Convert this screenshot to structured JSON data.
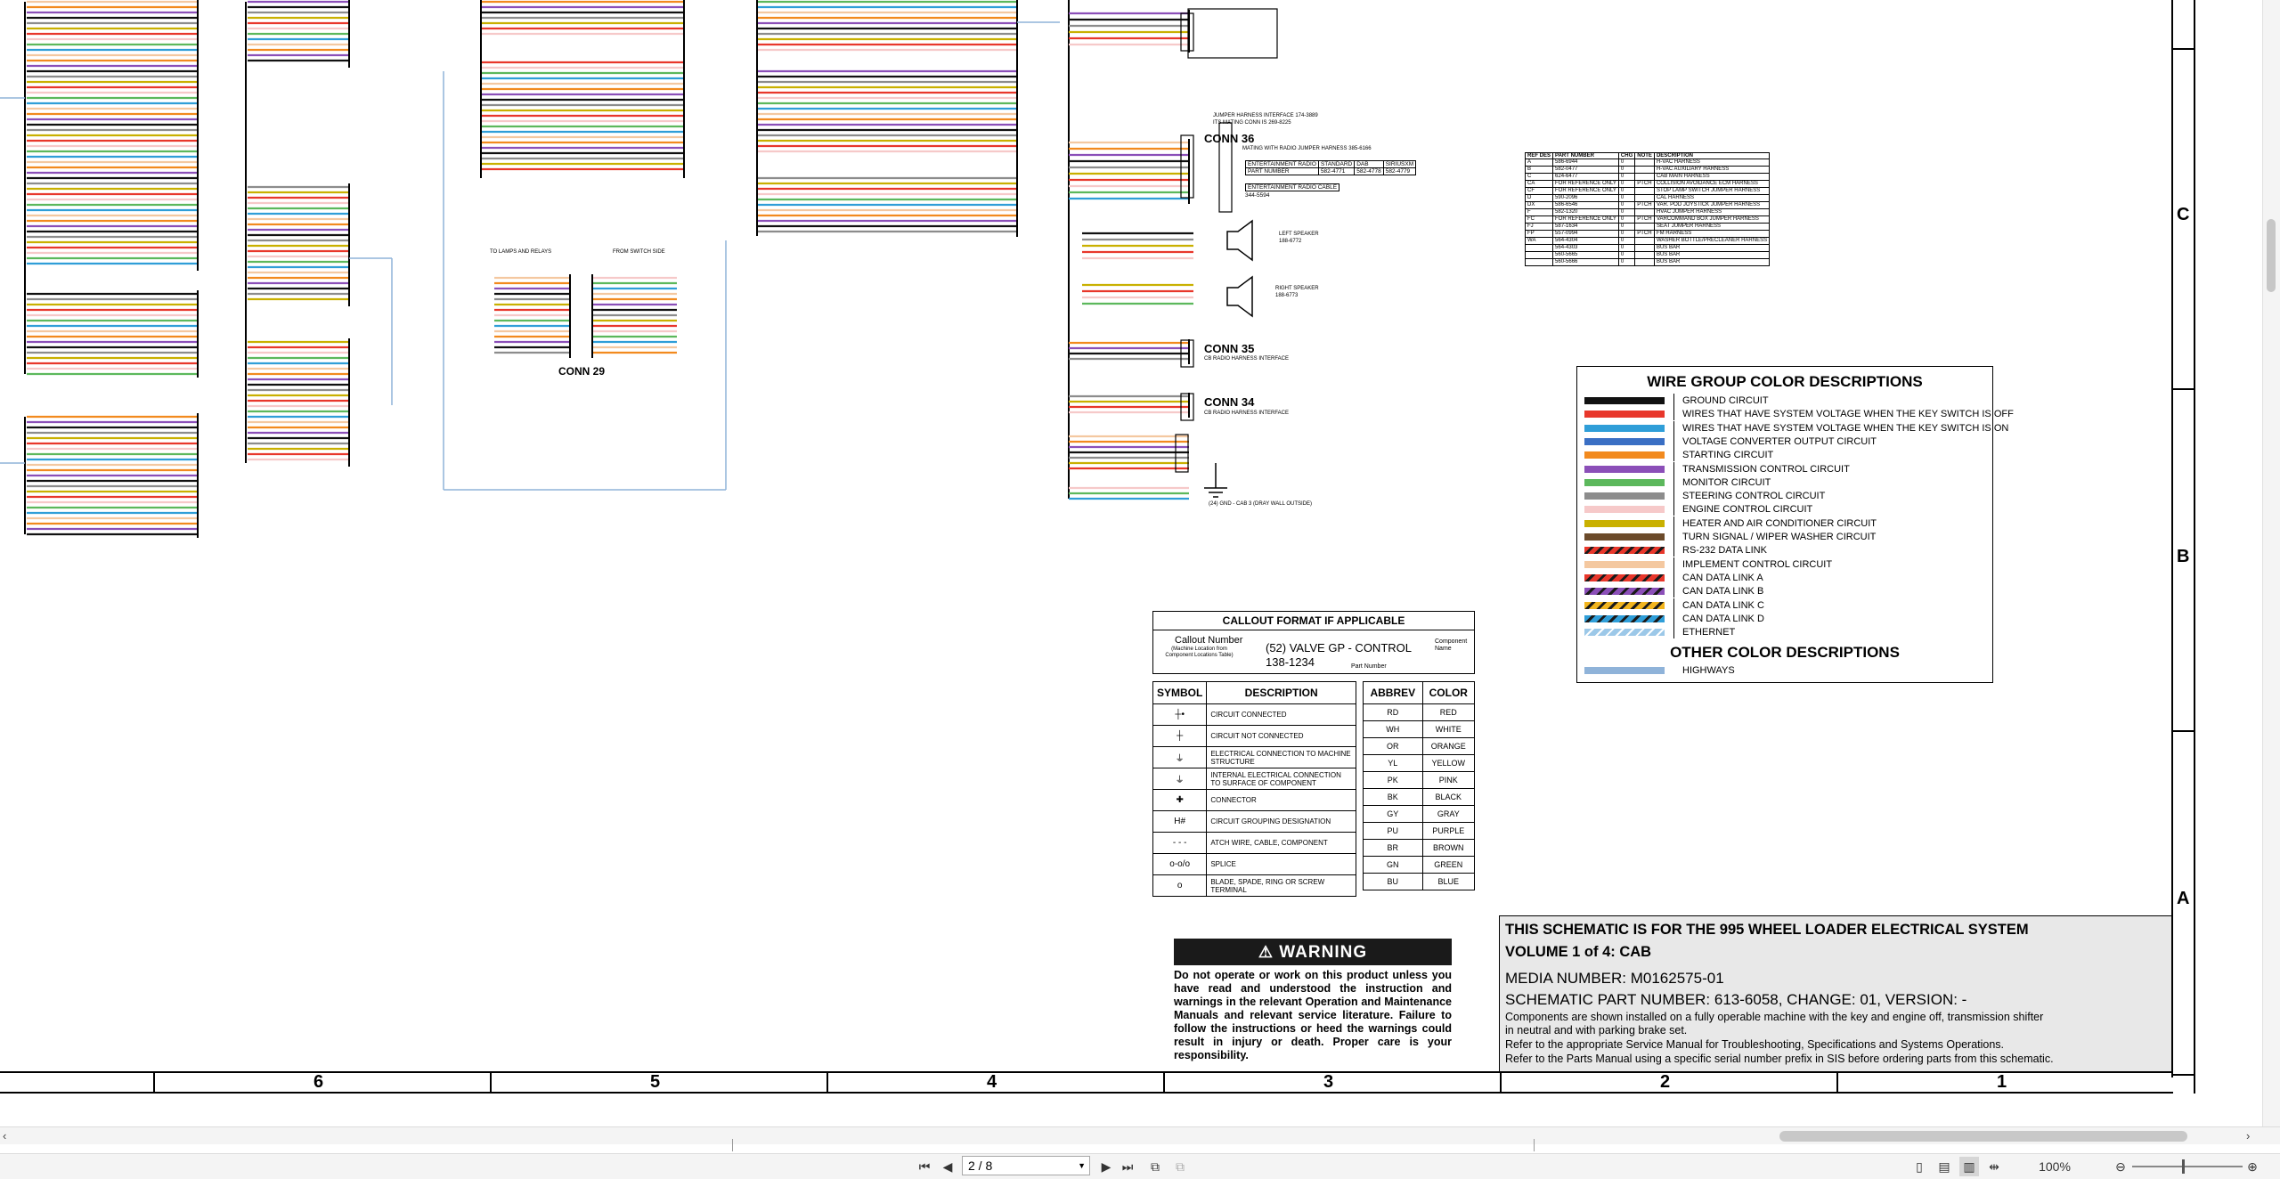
{
  "document": {
    "conn29_title": "CONN 29",
    "conn29_left_caption": "TO LAMPS AND RELAYS",
    "conn29_right_caption": "FROM SWITCH SIDE",
    "conn36_title": "CONN 36",
    "conn36_line1": "JUMPER HARNESS INTERFACE 174-3889",
    "conn36_line2": "ITS MATING CONN IS 269-8225",
    "conn36_line3": "MATING WITH RADIO JUMPER HARNESS 385-6166",
    "conn35_title": "CONN 35",
    "conn35_sub": "CB RADIO HARNESS INTERFACE",
    "conn34_title": "CONN 34",
    "conn34_sub": "CB RADIO HARNESS INTERFACE",
    "left_speaker": "LEFT SPEAKER",
    "left_speaker_pn": "188-6772",
    "right_speaker": "RIGHT SPEAKER",
    "right_speaker_pn": "188-6773",
    "gnd_note": "(24) GND - CAB 3 (DRAY WALL OUTSIDE)",
    "radio_table": {
      "header": [
        "ENTERTAINMENT RADIO",
        "STANDARD",
        "DAB",
        "SIRIUSXM"
      ],
      "row": [
        "PART NUMBER",
        "582-4771",
        "582-4778",
        "582-4779"
      ],
      "cable": "ENTERTAINMENT RADIO CABLE",
      "cable_pn": "344-5594"
    }
  },
  "ref_table": {
    "headers": [
      "REF DES",
      "PART NUMBER",
      "CHG",
      "NOTE",
      "DESCRIPTION"
    ],
    "rows": [
      [
        "A",
        "586-6944",
        "0",
        "",
        "H-VAC HARNESS"
      ],
      [
        "B",
        "582-0477",
        "0",
        "",
        "H-VAC AUXILIARY HARNESS"
      ],
      [
        "C",
        "624-6477",
        "0",
        "",
        "CAB MAIN HARNESS"
      ],
      [
        "CA",
        "FOR REFERENCE ONLY",
        "0",
        "PTCH",
        "COLLISION AVOIDANCE ECM HARNESS"
      ],
      [
        "CF",
        "FOR REFERENCE ONLY",
        "0",
        "",
        "STOP LAMP SWITCH JUMPER HARNESS"
      ],
      [
        "D",
        "590-2096",
        "0",
        "",
        "CAL HARNESS"
      ],
      [
        "DX",
        "586-6546",
        "0",
        "PTCH",
        "VAR. POD JOYSTICK JUMPER HARNESS"
      ],
      [
        "F",
        "582-1320",
        "0",
        "",
        "HVAC JUMPER HARNESS"
      ],
      [
        "FC",
        "FOR REFERENCE ONLY",
        "0",
        "PTCH",
        "VARCOMMAND BOX JUMPER HARNESS"
      ],
      [
        "FJ",
        "587-1634",
        "0",
        "",
        "SEAT JUMPER HARNESS"
      ],
      [
        "FP",
        "557-0994",
        "0",
        "PTCH",
        "FM HARNESS"
      ],
      [
        "WA",
        "564-4304",
        "0",
        "",
        "WASHER BOTTLE/PRECLEANER HARNESS"
      ],
      [
        "",
        "564-4303",
        "0",
        "",
        "BUS BAR"
      ],
      [
        "",
        "560-5665",
        "0",
        "",
        "BUS BAR"
      ],
      [
        "",
        "560-5666",
        "0",
        "",
        "BUS BAR"
      ]
    ]
  },
  "wire_group_legend": {
    "title": "WIRE GROUP COLOR DESCRIPTIONS",
    "items": [
      {
        "label": "GROUND CIRCUIT",
        "color": "#111111",
        "pattern": "solid"
      },
      {
        "label": "WIRES THAT HAVE SYSTEM VOLTAGE WHEN THE KEY SWITCH IS OFF",
        "color": "#e8372b",
        "pattern": "solid"
      },
      {
        "label": "WIRES THAT HAVE SYSTEM VOLTAGE WHEN THE KEY SWITCH IS ON",
        "color": "#2f9ed8",
        "pattern": "solid"
      },
      {
        "label": "VOLTAGE CONVERTER OUTPUT CIRCUIT",
        "color": "#3a6fc4",
        "pattern": "solid"
      },
      {
        "label": "STARTING CIRCUIT",
        "color": "#f28a1e",
        "pattern": "solid"
      },
      {
        "label": "TRANSMISSION CONTROL CIRCUIT",
        "color": "#8b4fb8",
        "pattern": "solid"
      },
      {
        "label": "MONITOR CIRCUIT",
        "color": "#5cb85c",
        "pattern": "solid"
      },
      {
        "label": "STEERING CONTROL CIRCUIT",
        "color": "#8c8c8c",
        "pattern": "solid"
      },
      {
        "label": "ENGINE CONTROL CIRCUIT",
        "color": "#f6c9c9",
        "pattern": "solid"
      },
      {
        "label": "HEATER AND AIR CONDITIONER CIRCUIT",
        "color": "#c9b000",
        "pattern": "solid"
      },
      {
        "label": "TURN SIGNAL / WIPER WASHER CIRCUIT",
        "color": "#6b4a2a",
        "pattern": "solid"
      },
      {
        "label": "RS-232 DATA LINK",
        "color": "#e8372b",
        "pattern": "striped"
      },
      {
        "label": "IMPLEMENT CONTROL CIRCUIT",
        "color": "#f4c8a0",
        "pattern": "solid"
      },
      {
        "label": "CAN DATA LINK A",
        "color": "#e8372b",
        "pattern": "striped-dark"
      },
      {
        "label": "CAN DATA LINK B",
        "color": "#8b4fb8",
        "pattern": "striped-dark"
      },
      {
        "label": "CAN DATA LINK C",
        "color": "#f2b51e",
        "pattern": "striped-dark"
      },
      {
        "label": "CAN DATA LINK D",
        "color": "#2f9ed8",
        "pattern": "striped-dark"
      },
      {
        "label": "ETHERNET",
        "color": "#9cc8e8",
        "pattern": "striped-light"
      }
    ],
    "other_title": "OTHER COLOR DESCRIPTIONS",
    "other_items": [
      {
        "label": "HIGHWAYS",
        "color": "#8fb3d9"
      }
    ]
  },
  "callout": {
    "title": "CALLOUT FORMAT IF APPLICABLE",
    "callout_number": "Callout Number",
    "callout_note": "(Machine Location from Component Locations Table)",
    "example_line1": "(52) VALVE GP - CONTROL",
    "example_line2": "138-1234",
    "component_name": "Component Name",
    "part_number": "Part Number"
  },
  "symbols": {
    "headers": [
      "SYMBOL",
      "DESCRIPTION"
    ],
    "rows": [
      {
        "symbol": "┼•",
        "desc": "CIRCUIT CONNECTED"
      },
      {
        "symbol": "┼",
        "desc": "CIRCUIT NOT CONNECTED"
      },
      {
        "symbol": "⏚",
        "desc": "ELECTRICAL CONNECTION TO MACHINE STRUCTURE"
      },
      {
        "symbol": "⏚",
        "desc": "INTERNAL ELECTRICAL CONNECTION TO SURFACE OF COMPONENT"
      },
      {
        "symbol": "✚",
        "desc": "CONNECTOR"
      },
      {
        "symbol": "H#",
        "desc": "CIRCUIT GROUPING DESIGNATION"
      },
      {
        "symbol": "- - -",
        "desc": "ATCH WIRE, CABLE, COMPONENT"
      },
      {
        "symbol": "o-o/o",
        "desc": "SPLICE"
      },
      {
        "symbol": "o",
        "desc": "BLADE, SPADE, RING OR SCREW TERMINAL"
      }
    ]
  },
  "abbrev": {
    "headers": [
      "ABBREV",
      "COLOR"
    ],
    "rows": [
      [
        "RD",
        "RED"
      ],
      [
        "WH",
        "WHITE"
      ],
      [
        "OR",
        "ORANGE"
      ],
      [
        "YL",
        "YELLOW"
      ],
      [
        "PK",
        "PINK"
      ],
      [
        "BK",
        "BLACK"
      ],
      [
        "GY",
        "GRAY"
      ],
      [
        "PU",
        "PURPLE"
      ],
      [
        "BR",
        "BROWN"
      ],
      [
        "GN",
        "GREEN"
      ],
      [
        "BU",
        "BLUE"
      ]
    ]
  },
  "warning": {
    "title": "WARNING",
    "text": "Do not operate or work on this product unless you have read and understood the instruction and warnings in the relevant Operation and Maintenance Manuals and relevant service literature. Failure to follow the instructions or heed the warnings could result in injury or death. Proper care is your responsibility."
  },
  "title_block": {
    "line1": "THIS SCHEMATIC IS FOR THE 995 WHEEL LOADER ELECTRICAL SYSTEM",
    "line2": "VOLUME 1 of 4: CAB",
    "media": "MEDIA NUMBER: M0162575-01",
    "part": "SCHEMATIC PART NUMBER: 613-6058, CHANGE: 01, VERSION: -",
    "note1": "Components are shown installed on a fully operable machine with the key and engine off, transmission shifter",
    "note2": "in neutral and with parking brake set.",
    "note3": "Refer to the appropriate Service Manual for Troubleshooting, Specifications and Systems Operations.",
    "note4": "Refer to the Parts Manual using a specific serial number prefix in SIS before ordering parts from this schematic."
  },
  "zones_bottom": [
    "6",
    "5",
    "4",
    "3",
    "2",
    "1"
  ],
  "zones_right": [
    "C",
    "B",
    "A"
  ],
  "viewer": {
    "page_value": "2 / 8",
    "zoom": "100%"
  }
}
